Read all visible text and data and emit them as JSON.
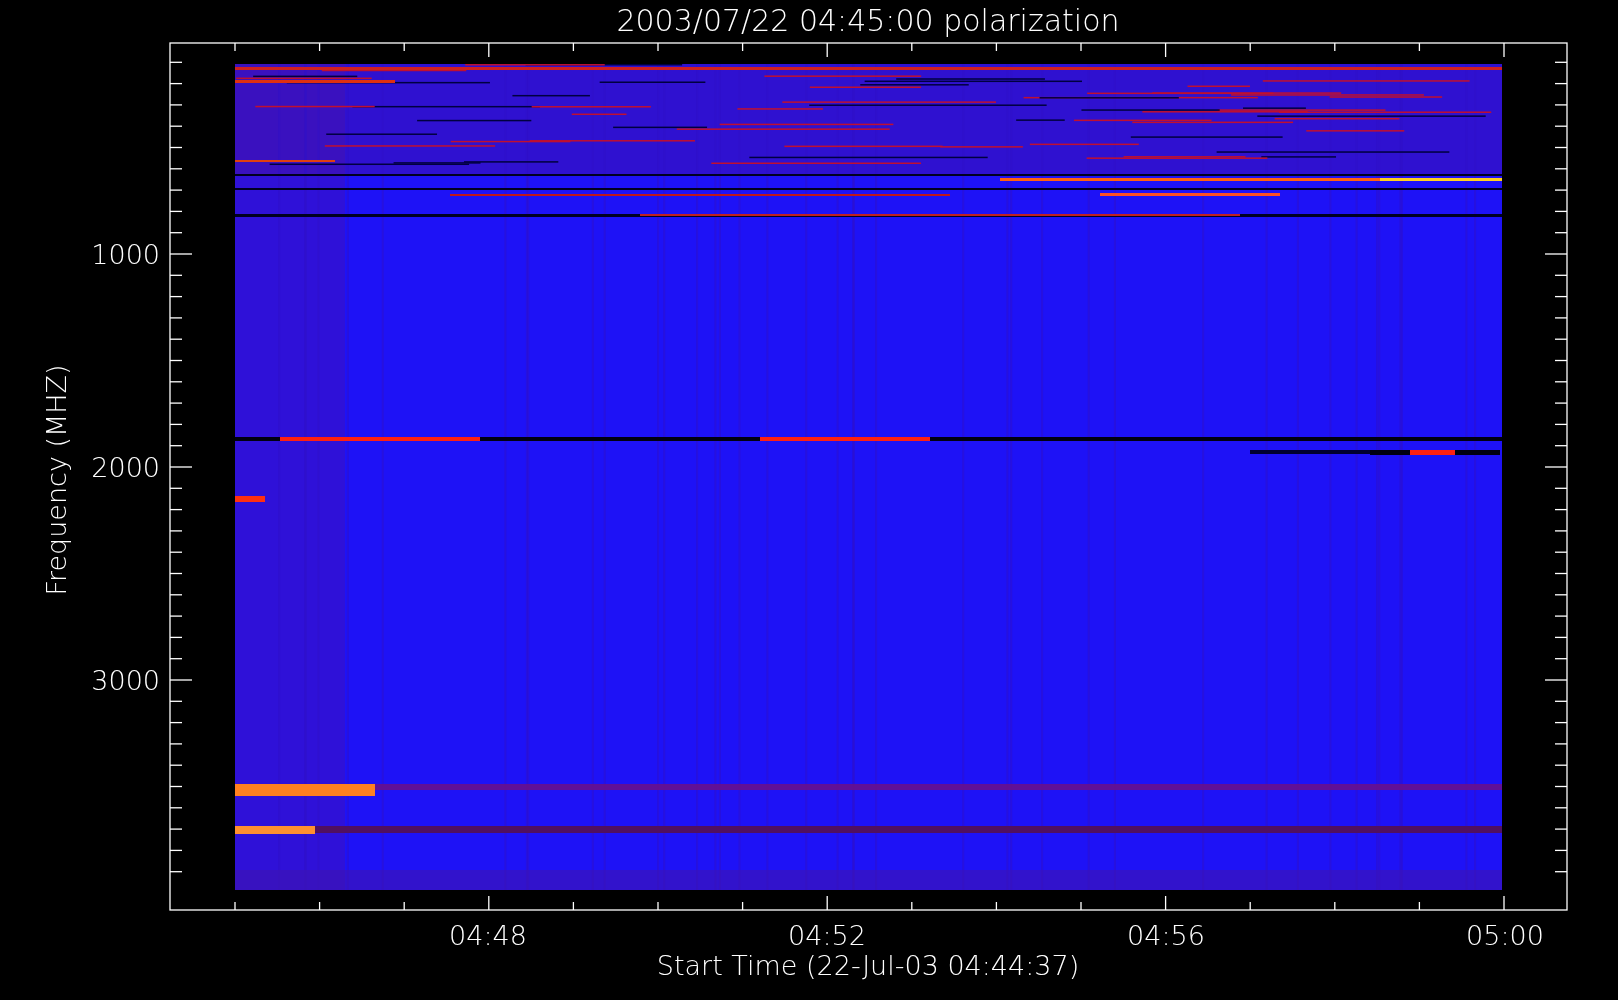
{
  "plot": {
    "title": "2003/07/22 04:45:00 polarization",
    "xlabel": "Start Time (22-Jul-03 04:44:37)",
    "ylabel": "Frequency (MHZ)",
    "xtick_labels": [
      "04:48",
      "04:52",
      "04:56",
      "05:00"
    ],
    "ytick_labels": [
      "1000",
      "2000",
      "3000"
    ]
  }
}
